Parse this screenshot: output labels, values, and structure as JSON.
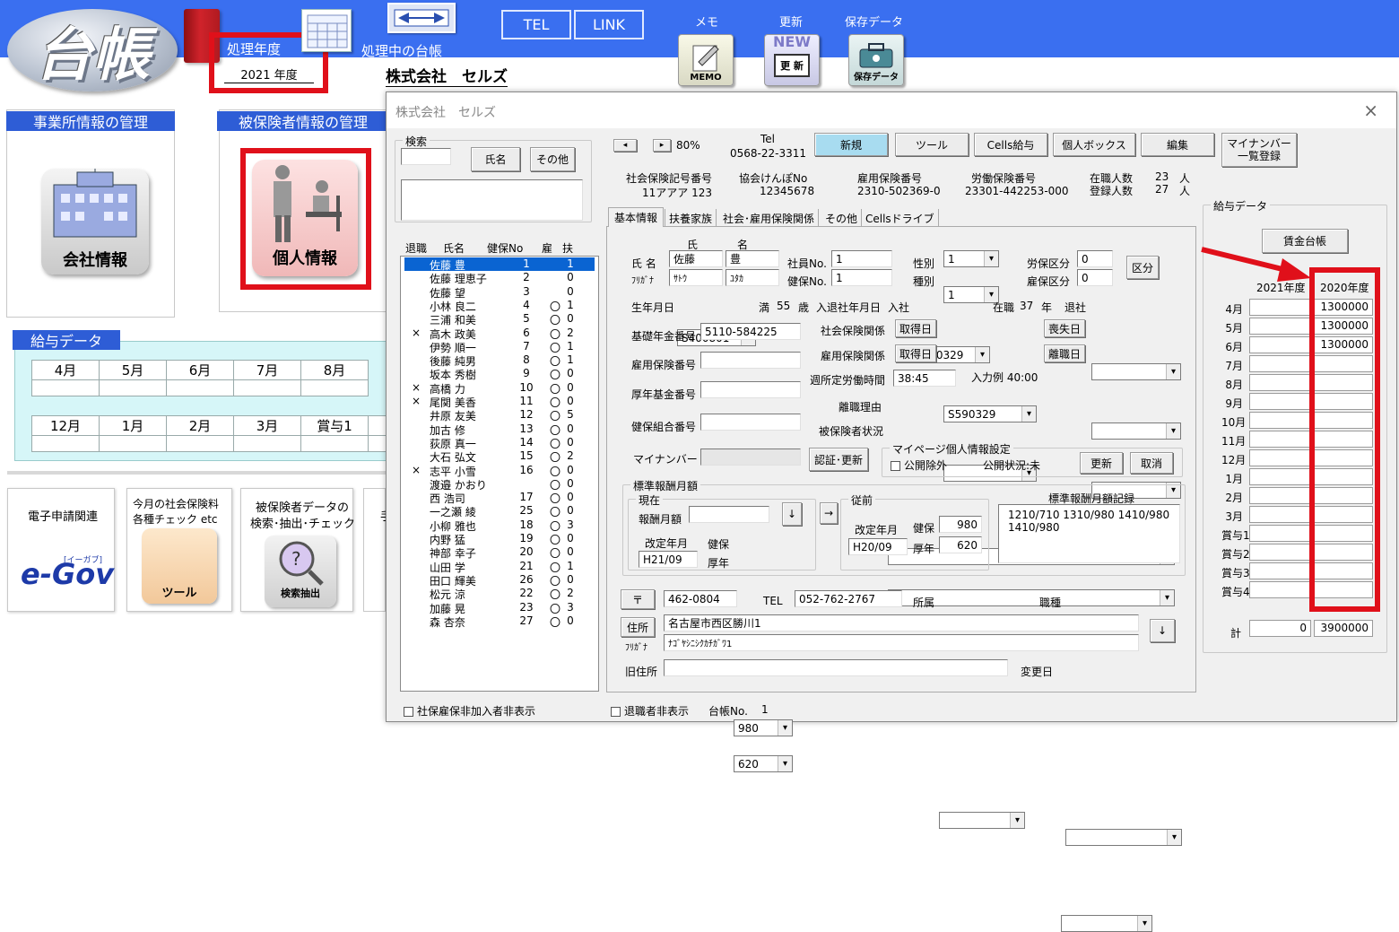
{
  "header": {
    "logo_text": "台帳",
    "fiscal_year_label": "処理年度",
    "fiscal_year_value": "2021 年度",
    "current_ledger_label": "処理中の台帳",
    "company_name": "株式会社　セルズ",
    "tel_label": "TEL",
    "link_label": "LINK",
    "memo_label": "メモ",
    "memo_icon_text": "MEMO",
    "update_label": "更新",
    "update_icon_new": "NEW",
    "update_icon_text": "更 新",
    "save_label": "保存データ",
    "save_icon_text": "保存データ"
  },
  "left": {
    "office_panel_title": "事業所情報の管理",
    "office_button_label": "会社情報",
    "insured_panel_title": "被保険者情報の管理",
    "insured_button_label": "個人情報",
    "salary_title": "給与データ",
    "months_row1": [
      "4月",
      "5月",
      "6月",
      "7月",
      "8月"
    ],
    "months_row2": [
      "12月",
      "1月",
      "2月",
      "3月",
      "賞与1",
      "賞"
    ],
    "egov_title": "電子申請関連",
    "egov_logo": "e-Gov",
    "egov_sub": "[イーガブ]",
    "check_title_1": "今月の社会保険料",
    "check_title_2": "各種チェック  etc",
    "check_button": "ツール",
    "search_title_1": "被保険者データの",
    "search_title_2": "検索･抽出･チェック",
    "search_button": "検索抽出",
    "extra_title": "手"
  },
  "dialog": {
    "title": "株式会社　セルズ",
    "close_icon": "×",
    "search_group": "検索",
    "search_value": "",
    "name_btn": "氏名",
    "other_btn": "その他",
    "list_headers": [
      "退職",
      "氏名",
      "健保No",
      "雇",
      "扶"
    ],
    "employees": [
      {
        "ret": "",
        "name": "佐藤 豊",
        "no": "1",
        "ko": "",
        "fu": "1"
      },
      {
        "ret": "",
        "name": "佐藤 理恵子",
        "no": "2",
        "ko": "",
        "fu": "0"
      },
      {
        "ret": "",
        "name": "佐藤 望",
        "no": "3",
        "ko": "",
        "fu": "0"
      },
      {
        "ret": "",
        "name": "小林 良二",
        "no": "4",
        "ko": "〇",
        "fu": "1"
      },
      {
        "ret": "",
        "name": "三浦 和美",
        "no": "5",
        "ko": "〇",
        "fu": "0"
      },
      {
        "ret": "×",
        "name": "高木 政美",
        "no": "6",
        "ko": "〇",
        "fu": "2"
      },
      {
        "ret": "",
        "name": "伊勢 順一",
        "no": "7",
        "ko": "〇",
        "fu": "1"
      },
      {
        "ret": "",
        "name": "後藤 純男",
        "no": "8",
        "ko": "〇",
        "fu": "1"
      },
      {
        "ret": "",
        "name": "坂本 秀樹",
        "no": "9",
        "ko": "〇",
        "fu": "0"
      },
      {
        "ret": "×",
        "name": "高橋 力",
        "no": "10",
        "ko": "〇",
        "fu": "0"
      },
      {
        "ret": "×",
        "name": "尾関 美香",
        "no": "11",
        "ko": "〇",
        "fu": "0"
      },
      {
        "ret": "",
        "name": "井原 友美",
        "no": "12",
        "ko": "〇",
        "fu": "5"
      },
      {
        "ret": "",
        "name": "加古 修",
        "no": "13",
        "ko": "〇",
        "fu": "0"
      },
      {
        "ret": "",
        "name": "荻原 真一",
        "no": "14",
        "ko": "〇",
        "fu": "0"
      },
      {
        "ret": "",
        "name": "大石 弘文",
        "no": "15",
        "ko": "〇",
        "fu": "2"
      },
      {
        "ret": "×",
        "name": "志平 小雪",
        "no": "16",
        "ko": "〇",
        "fu": "0"
      },
      {
        "ret": "",
        "name": "渡邉 かおり",
        "no": "",
        "ko": "〇",
        "fu": "0"
      },
      {
        "ret": "",
        "name": "西 浩司",
        "no": "17",
        "ko": "〇",
        "fu": "0"
      },
      {
        "ret": "",
        "name": "一之瀬 綾",
        "no": "25",
        "ko": "〇",
        "fu": "0"
      },
      {
        "ret": "",
        "name": "小柳 雅也",
        "no": "18",
        "ko": "〇",
        "fu": "3"
      },
      {
        "ret": "",
        "name": "内野 猛",
        "no": "19",
        "ko": "〇",
        "fu": "0"
      },
      {
        "ret": "",
        "name": "神部 幸子",
        "no": "20",
        "ko": "〇",
        "fu": "0"
      },
      {
        "ret": "",
        "name": "山田 学",
        "no": "21",
        "ko": "〇",
        "fu": "1"
      },
      {
        "ret": "",
        "name": "田口 輝美",
        "no": "26",
        "ko": "〇",
        "fu": "0"
      },
      {
        "ret": "",
        "name": "松元 涼",
        "no": "22",
        "ko": "〇",
        "fu": "2"
      },
      {
        "ret": "",
        "name": "加藤 晃",
        "no": "23",
        "ko": "〇",
        "fu": "3"
      },
      {
        "ret": "",
        "name": "森 杏奈",
        "no": "27",
        "ko": "〇",
        "fu": "0"
      }
    ],
    "hide_uninsured": "社保雇保非加入者非表示",
    "hide_retired": "退職者非表示",
    "ledger_no_label": "台帳No.",
    "ledger_no": "1",
    "zoom": "80%",
    "tel_label": "Tel",
    "tel_value": "0568-22-3311",
    "toolbar": {
      "new": "新規",
      "tool": "ツール",
      "cells_salary": "Cells給与",
      "personal_box": "個人ボックス",
      "edit": "編集",
      "mynumber_1": "マイナンバー",
      "mynumber_2": "一覧登録"
    },
    "info": {
      "shaho_label": "社会保険記号番号",
      "shaho_value": "11アアア 123",
      "kyokai_label": "協会けんぽNo",
      "kyokai_value": "12345678",
      "koyo_label": "雇用保険番号",
      "koyo_value": "2310-502369-0",
      "rodo_label": "労働保険番号",
      "rodo_value": "23301-442253-000",
      "zaishoku_label": "在職人数",
      "zaishoku_value": "23",
      "zaishoku_unit": "人",
      "toroku_label": "登録人数",
      "toroku_value": "27",
      "toroku_unit": "人"
    },
    "tabs": [
      "基本情報",
      "扶養家族",
      "社会･雇用保険関係",
      "その他",
      "Cellsドライブ"
    ],
    "basic": {
      "name_label": "氏 名",
      "kana_label": "ﾌﾘｶﾞﾅ",
      "sei_label": "氏",
      "mei_label": "名",
      "sei": "佐藤",
      "mei": "豊",
      "sei_kana": "ｻﾄｳ",
      "mei_kana": "ﾕﾀｶ",
      "emp_no_label": "社員No.",
      "emp_no": "1",
      "kenpo_no_label": "健保No.",
      "kenpo_no": "1",
      "sex_label": "性別",
      "sex": "1",
      "type_label": "種別",
      "type": "1",
      "rouho_label": "労保区分",
      "rouho": "0",
      "koho_label": "雇保区分",
      "koho": "0",
      "kubun_btn": "区分",
      "birth_label": "生年月日",
      "birth": "S400801",
      "age_prefix": "満",
      "age": "55",
      "age_unit": "歳",
      "join_label": "入退社年月日",
      "join_prefix": "入社",
      "join": "S590329",
      "tenure_prefix": "在職",
      "tenure": "37",
      "tenure_unit": "年",
      "retire_label": "退社",
      "pension_label": "基礎年金番号",
      "pension": "5110-584225",
      "shaho_rel_label": "社会保険関係",
      "acquire_btn": "取得日",
      "shaho_acquire": "S590329",
      "lose_btn": "喪失日",
      "koyo_rel_label": "雇用保険関係",
      "koyo_acquire_btn": "取得日",
      "leave_btn": "離職日",
      "koyo_no_label": "雇用保険番号",
      "weekly_label": "週所定労働時間",
      "weekly": "38:45",
      "weekly_example": "入力例  40:00",
      "kosei_label": "厚年基金番号",
      "leave_reason_label": "離職理由",
      "kumiai_label": "健保組合番号",
      "insured_status_label": "被保険者状況",
      "mynumber_label": "マイナンバー",
      "auth_btn": "認証･更新",
      "myportal_group": "マイページ個人情報設定",
      "public_exclude": "公開除外",
      "public_status": "公開状況:未",
      "update_btn": "更新",
      "cancel_btn": "取消",
      "std_group": "標準報酬月額",
      "current_group": "現在",
      "monthly_label": "報酬月額",
      "revised_label": "改定年月",
      "revised": "H21/09",
      "kenpo_label": "健保",
      "kenpo": "980",
      "kosei_short": "厚年",
      "kosei_val": "620",
      "prev_group": "従前",
      "prev_revised_label": "改定年月",
      "prev_revised": "H20/09",
      "prev_kenpo": "980",
      "prev_kosei": "620",
      "record_label": "標準報酬月額記録",
      "record_line1": "1210/710  1310/980 1410/980",
      "record_line2": "1410/980",
      "arrow_down": "↓",
      "arrow_right": "→",
      "zip_btn": "〒",
      "zip": "462-0804",
      "tel_label": "TEL",
      "tel": "052-762-2767",
      "dept_label": "所属",
      "job_label": "職種",
      "addr_btn": "住所",
      "addr_kana_label": "ﾌﾘｶﾞﾅ",
      "address": "名古屋市西区勝川1",
      "address_kana": "ﾅｺﾞﾔｼﾆｼｸｶﾁｶﾞﾜ1",
      "old_addr_label": "旧住所",
      "change_date_label": "変更日"
    },
    "salary": {
      "group": "給与データ",
      "wage_btn": "賃金台帳",
      "col1": "2021年度",
      "col2": "2020年度",
      "rows": [
        {
          "m": "4月",
          "a": "",
          "b": "1300000"
        },
        {
          "m": "5月",
          "a": "",
          "b": "1300000"
        },
        {
          "m": "6月",
          "a": "",
          "b": "1300000"
        },
        {
          "m": "7月",
          "a": "",
          "b": ""
        },
        {
          "m": "8月",
          "a": "",
          "b": ""
        },
        {
          "m": "9月",
          "a": "",
          "b": ""
        },
        {
          "m": "10月",
          "a": "",
          "b": ""
        },
        {
          "m": "11月",
          "a": "",
          "b": ""
        },
        {
          "m": "12月",
          "a": "",
          "b": ""
        },
        {
          "m": "1月",
          "a": "",
          "b": ""
        },
        {
          "m": "2月",
          "a": "",
          "b": ""
        },
        {
          "m": "3月",
          "a": "",
          "b": ""
        },
        {
          "m": "賞与1",
          "a": "",
          "b": ""
        },
        {
          "m": "賞与2",
          "a": "",
          "b": ""
        },
        {
          "m": "賞与3",
          "a": "",
          "b": ""
        },
        {
          "m": "賞与4",
          "a": "",
          "b": ""
        }
      ],
      "total_label": "計",
      "total_a": "0",
      "total_b": "3900000"
    }
  },
  "colors": {
    "accent_blue": "#3a6ff0",
    "highlight_red": "#e0101a",
    "selected_row": "#0a64d2",
    "new_btn": "#a8dcf0"
  }
}
